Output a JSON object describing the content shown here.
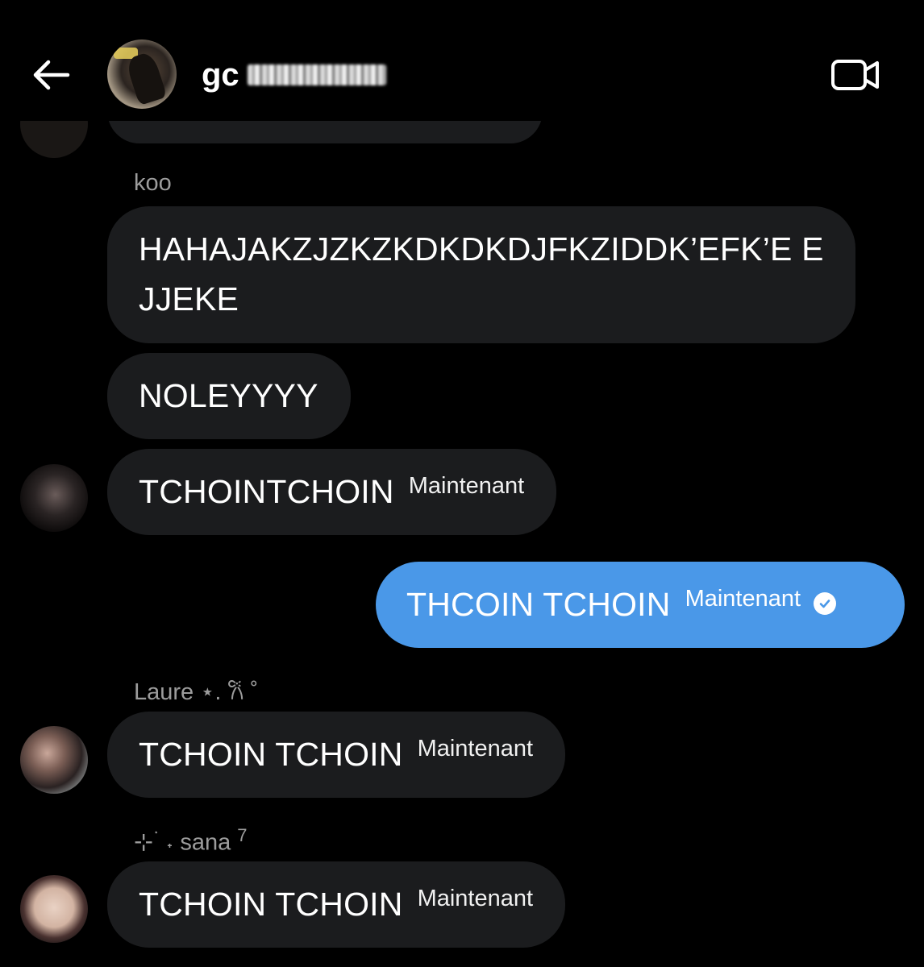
{
  "header": {
    "title": "gc",
    "back_icon": "arrow-left-icon",
    "video_icon": "video-camera-icon"
  },
  "messages": [
    {
      "sender": "koo",
      "bubbles": [
        {
          "text": "HAHAJAKZJZKZKDKDKDJFKZIDDK’EFK’E EJJEKE"
        },
        {
          "text": "NOLEYYYY"
        },
        {
          "text": "TCHOINTCHOIN",
          "time": "Maintenant"
        }
      ]
    },
    {
      "own": true,
      "text": "THCOIN TCHOIN",
      "time": "Maintenant",
      "status_icon": "check-circle-icon"
    },
    {
      "sender": "Laure ⋆. 𐙚 ˚",
      "text": "TCHOIN TCHOIN",
      "time": "Maintenant"
    },
    {
      "sender": "⊹ ࣪ ˖ sana",
      "sender_badge": "7",
      "text": "TCHOIN TCHOIN",
      "time": "Maintenant"
    }
  ],
  "colors": {
    "background": "#000000",
    "incoming_bubble": "#1b1c1e",
    "outgoing_bubble": "#4a98e8",
    "sender_name": "#9c9c9c"
  }
}
